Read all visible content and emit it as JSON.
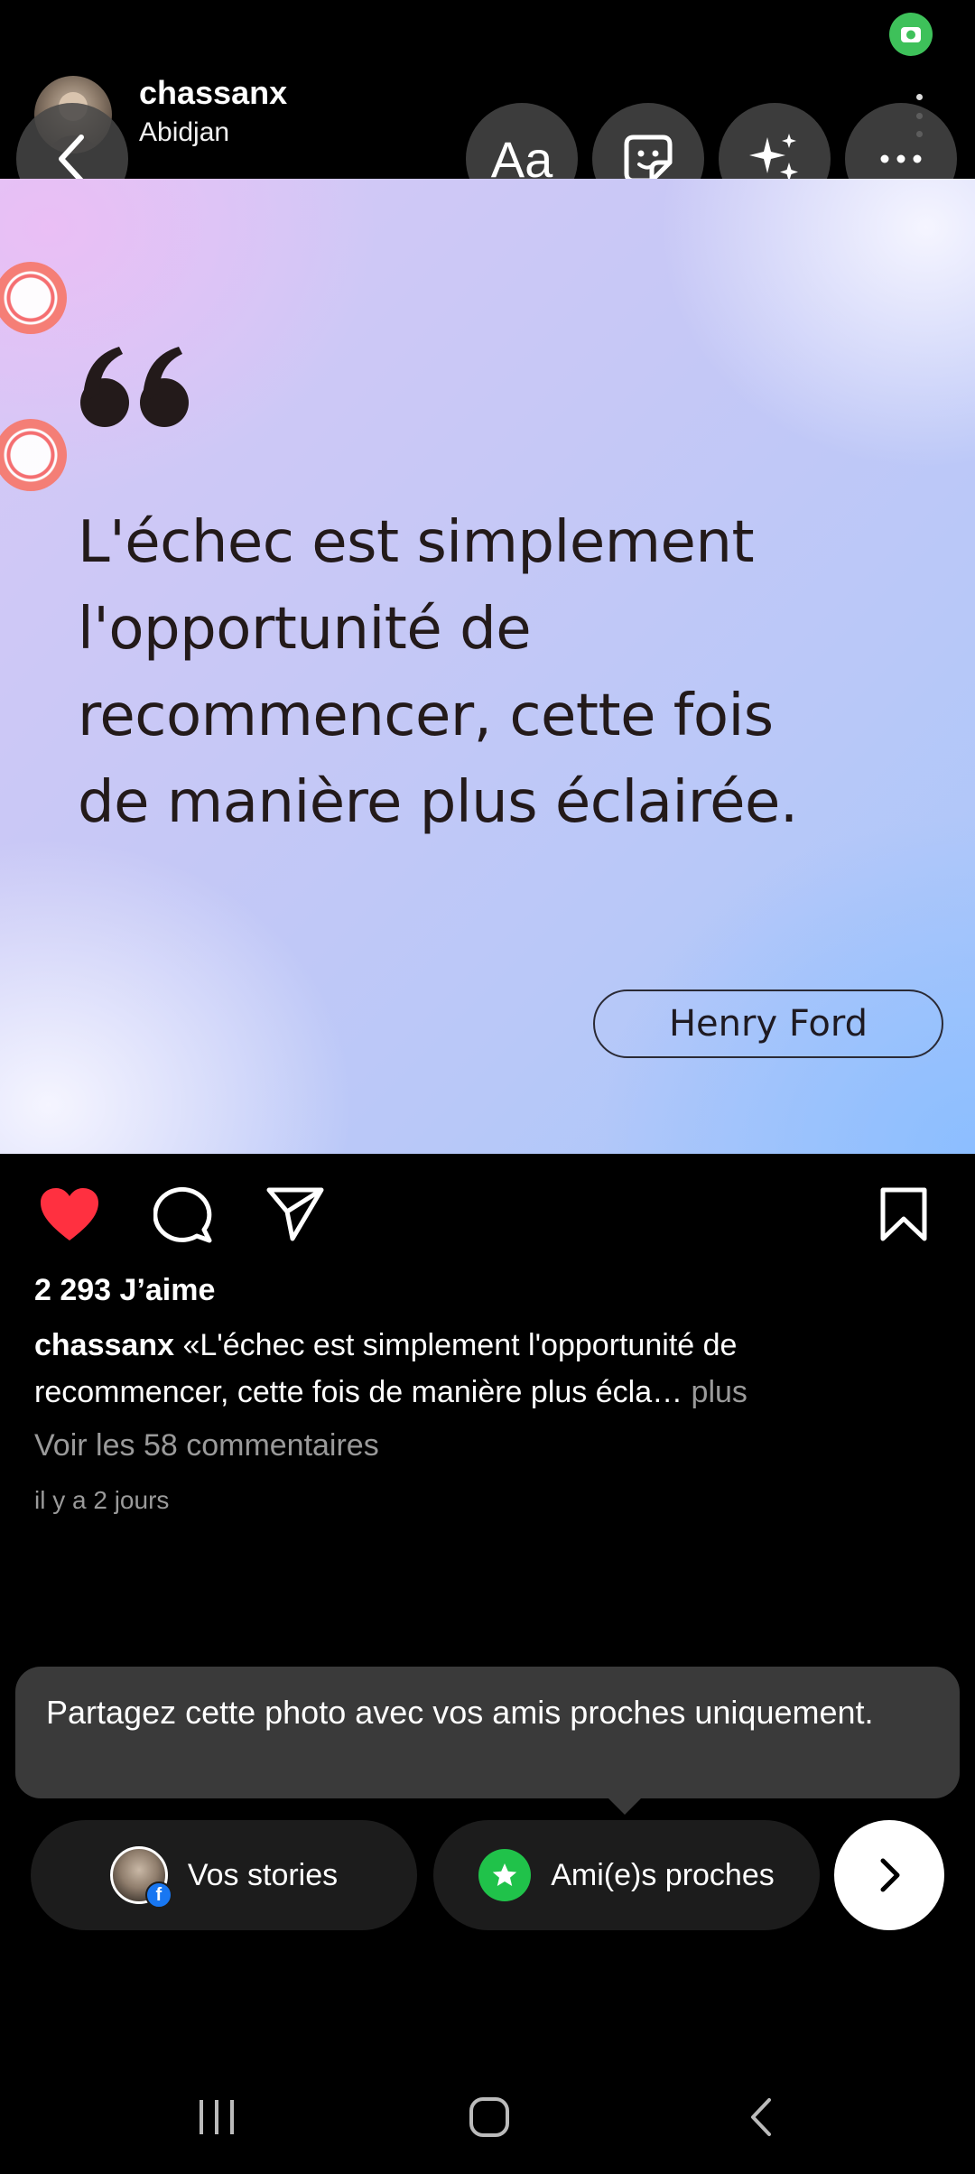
{
  "header": {
    "username": "chassanx",
    "location": "Abidjan"
  },
  "editor_tools": {
    "text_label": "Aa"
  },
  "post": {
    "quote": "L'échec est simplement l'opportunité de recommencer, cette fois de manière plus éclairée.",
    "quote_lines": [
      "L'échec est simplement",
      "l'opportunité de",
      "recommencer, cette fois",
      "de manière plus éclairée."
    ],
    "author": "Henry Ford",
    "liked": true,
    "likes": "2 293 J’aime",
    "caption_user": "chassanx",
    "caption_text": " «L'échec est simplement l'opportunité de recommencer, cette fois de manière plus écla…",
    "caption_more": " plus",
    "view_comments": "Voir les 58 commentaires",
    "time_ago": "il y a 2 jours"
  },
  "tooltip": {
    "text": "Partagez cette photo avec vos amis proches uniquement."
  },
  "share_options": {
    "stories_label": "Vos stories",
    "close_friends_label": "Ami(e)s proches"
  },
  "colors": {
    "like_red": "#ff3040",
    "close_friends_green": "#20c24a",
    "status_cam_green": "#3ec15a",
    "facebook_blue": "#1877f2"
  },
  "icons": {
    "back": "chevron-left-icon",
    "sticker": "sticker-icon",
    "effects": "sparkles-icon",
    "more": "more-horizontal-icon",
    "like": "heart-icon",
    "comment": "comment-icon",
    "share": "send-icon",
    "save": "bookmark-icon",
    "next": "chevron-right-icon"
  }
}
